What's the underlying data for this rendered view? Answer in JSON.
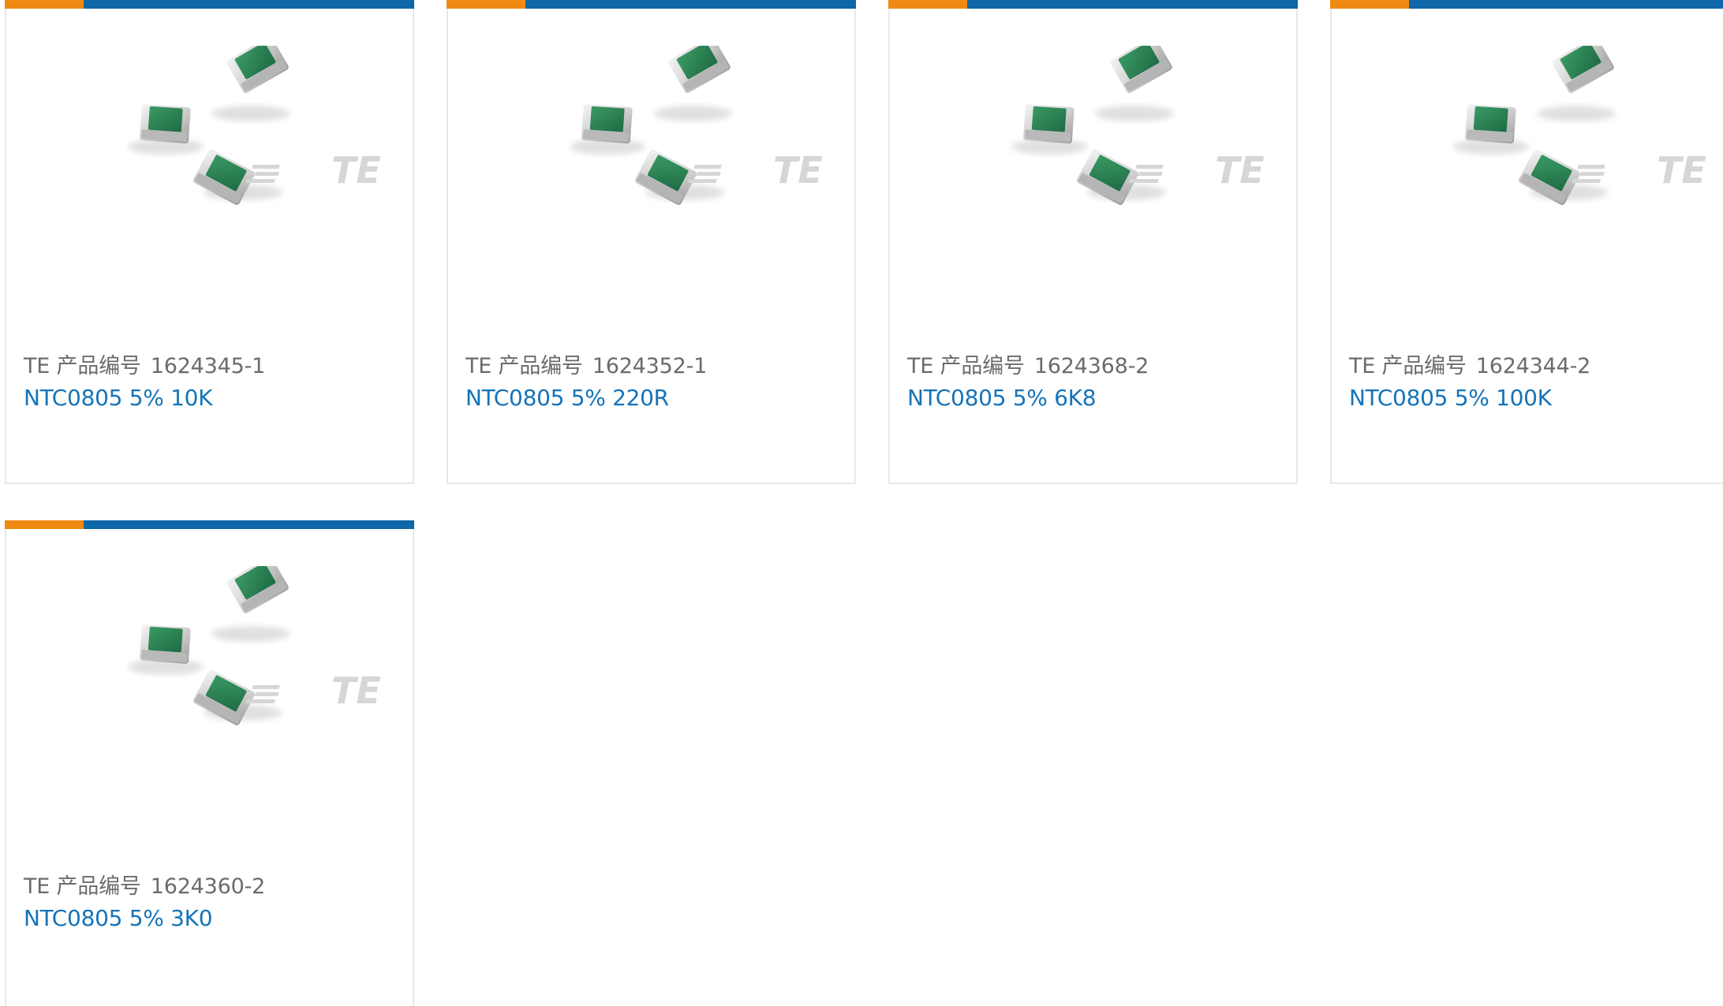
{
  "colors": {
    "accent_orange": "#f08a12",
    "brand_blue": "#0e67a8",
    "link_blue": "#1473b8",
    "label_gray": "#6b6b6b",
    "chip_green": "#2f8a5a"
  },
  "products": [
    {
      "pn_label": "TE 产品编号",
      "pn_value": "1624345-1",
      "description": "NTC0805 5% 10K",
      "image_icon": "smd-thermistor-chips-image",
      "logo_text": "TE"
    },
    {
      "pn_label": "TE 产品编号",
      "pn_value": "1624352-1",
      "description": "NTC0805 5% 220R",
      "image_icon": "smd-thermistor-chips-image",
      "logo_text": "TE"
    },
    {
      "pn_label": "TE 产品编号",
      "pn_value": "1624368-2",
      "description": "NTC0805 5% 6K8",
      "image_icon": "smd-thermistor-chips-image",
      "logo_text": "TE"
    },
    {
      "pn_label": "TE 产品编号",
      "pn_value": "1624344-2",
      "description": "NTC0805 5% 100K",
      "image_icon": "smd-thermistor-chips-image",
      "logo_text": "TE"
    },
    {
      "pn_label": "TE 产品编号",
      "pn_value": "1624360-2",
      "description": "NTC0805 5% 3K0",
      "image_icon": "smd-thermistor-chips-image",
      "logo_text": "TE"
    }
  ]
}
